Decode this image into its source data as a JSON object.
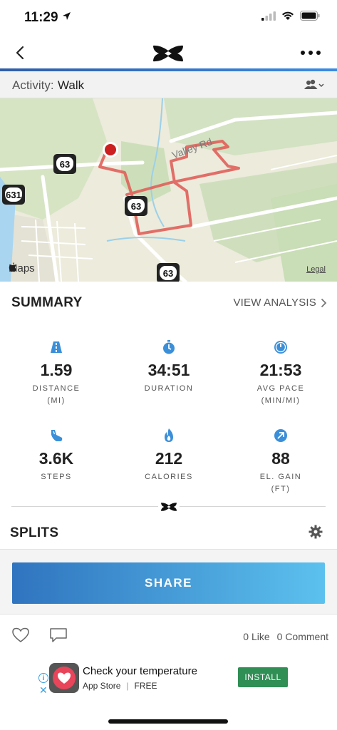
{
  "status": {
    "time": "11:29"
  },
  "activity": {
    "label": "Activity:",
    "value": "Walk"
  },
  "map": {
    "road_label": "Valley Rd",
    "shields": [
      "63",
      "631",
      "63",
      "63"
    ],
    "attribution": "Maps",
    "legal": "Legal",
    "route_color": "#e0605a"
  },
  "summary": {
    "title": "SUMMARY",
    "view_analysis": "VIEW ANALYSIS"
  },
  "stats": [
    {
      "value": "1.59",
      "label_line1": "DISTANCE",
      "label_line2": "(MI)",
      "icon": "road-icon"
    },
    {
      "value": "34:51",
      "label_line1": "DURATION",
      "label_line2": "",
      "icon": "stopwatch-icon"
    },
    {
      "value": "21:53",
      "label_line1": "AVG PACE",
      "label_line2": "(MIN/MI)",
      "icon": "gauge-icon"
    },
    {
      "value": "3.6K",
      "label_line1": "STEPS",
      "label_line2": "",
      "icon": "shoe-icon"
    },
    {
      "value": "212",
      "label_line1": "CALORIES",
      "label_line2": "",
      "icon": "flame-icon"
    },
    {
      "value": "88",
      "label_line1": "EL. GAIN",
      "label_line2": "(FT)",
      "icon": "arrow-up-right-icon"
    }
  ],
  "splits": {
    "title": "SPLITS"
  },
  "share": {
    "label": "SHARE"
  },
  "social": {
    "likes": "0 Like",
    "comments": "0 Comment"
  },
  "ad": {
    "title": "Check your temperature",
    "store": "App Store",
    "price": "FREE",
    "install": "INSTALL"
  },
  "colors": {
    "accent": "#3a8de0",
    "icon_blue": "#3b8fd9",
    "install_green": "#2f8f55"
  }
}
